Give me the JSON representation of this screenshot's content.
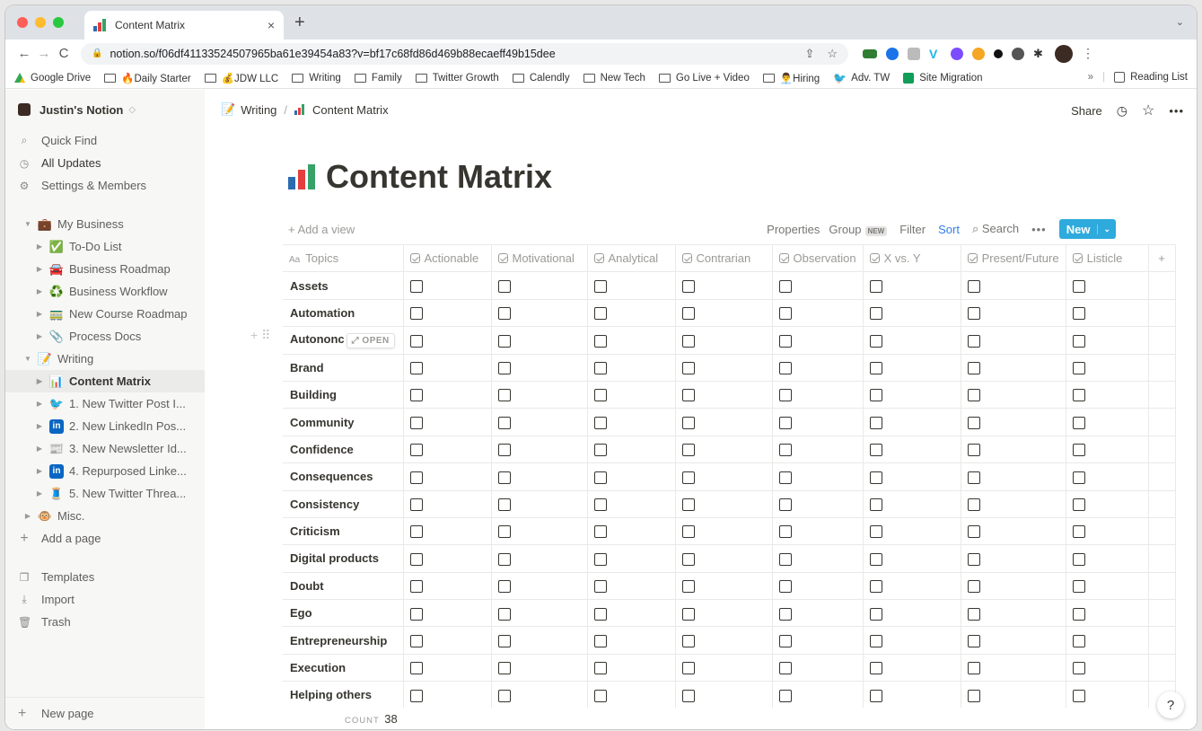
{
  "browser": {
    "tab_title": "Content Matrix",
    "tab_close": "×",
    "new_tab": "+",
    "tab_menu": "⌄",
    "url": "notion.so/f06df41133524507965ba61e39454a83?v=bf17c68fd86d469b88ecaeff49b15dee",
    "nav": {
      "back": "←",
      "forward": "→",
      "reload": "C"
    },
    "bookmarks": [
      {
        "label": "Google Drive",
        "icon": "google-drive-icon"
      },
      {
        "label": "🔥Daily Starter",
        "icon": "folder-icon"
      },
      {
        "label": "💰JDW LLC",
        "icon": "folder-icon"
      },
      {
        "label": "Writing",
        "icon": "folder-icon"
      },
      {
        "label": "Family",
        "icon": "folder-icon"
      },
      {
        "label": "Twitter Growth",
        "icon": "folder-icon"
      },
      {
        "label": "Calendly",
        "icon": "folder-icon"
      },
      {
        "label": "New Tech",
        "icon": "folder-icon"
      },
      {
        "label": "Go Live + Video",
        "icon": "folder-icon"
      },
      {
        "label": "👨‍💼Hiring",
        "icon": "folder-icon"
      },
      {
        "label": "Adv. TW",
        "icon": "twitter-icon"
      },
      {
        "label": "Site Migration",
        "icon": "google-sheets-icon"
      }
    ],
    "overflow": "»",
    "reading_list": "Reading List"
  },
  "sidebar": {
    "workspace": "Justin's Notion",
    "top_items": [
      {
        "label": "Quick Find",
        "icon": "⌕"
      },
      {
        "label": "All Updates",
        "icon": "◷"
      },
      {
        "label": "Settings & Members",
        "icon": "⚙"
      }
    ],
    "pages": [
      {
        "label": "My Business",
        "emoji": "💼",
        "level": 0,
        "open": true
      },
      {
        "label": "To-Do List",
        "emoji": "✅",
        "level": 1
      },
      {
        "label": "Business Roadmap",
        "emoji": "🚘",
        "level": 1
      },
      {
        "label": "Business Workflow",
        "emoji": "♻️",
        "level": 1
      },
      {
        "label": "New Course Roadmap",
        "emoji": "🚃",
        "level": 1
      },
      {
        "label": "Process Docs",
        "emoji": "📎",
        "level": 1
      },
      {
        "label": "Writing",
        "emoji": "📝",
        "level": 0,
        "open": true
      },
      {
        "label": "Content Matrix",
        "emoji": "📊",
        "level": 1,
        "active": true
      },
      {
        "label": "1. New Twitter Post I...",
        "emoji": "🐦",
        "level": 1
      },
      {
        "label": "2. New LinkedIn Pos...",
        "emoji": "in",
        "level": 1
      },
      {
        "label": "3. New Newsletter Id...",
        "emoji": "📰",
        "level": 1
      },
      {
        "label": "4. Repurposed Linke...",
        "emoji": "in",
        "level": 1
      },
      {
        "label": "5. New Twitter Threa...",
        "emoji": "🧵",
        "level": 1
      },
      {
        "label": "Misc.",
        "emoji": "🐵",
        "level": 0
      }
    ],
    "add_page": "Add a page",
    "bottom_items": [
      {
        "label": "Templates",
        "icon": "❐"
      },
      {
        "label": "Import",
        "icon": "⤓"
      },
      {
        "label": "Trash",
        "icon": "🗑"
      }
    ],
    "new_page": "New page"
  },
  "topbar": {
    "breadcrumb": [
      "Writing",
      "Content Matrix"
    ],
    "share": "Share",
    "more": "•••"
  },
  "page": {
    "title": "Content Matrix",
    "add_view": "+ Add a view",
    "view_controls": [
      "Properties",
      "Group",
      "Filter",
      "Sort",
      "Search"
    ],
    "group_badge": "NEW",
    "more": "•••",
    "new_button": "New",
    "new_chevron": "⌄"
  },
  "table": {
    "title_column": "Topics",
    "title_column_icon": "Aa",
    "columns": [
      "Actionable",
      "Motivational",
      "Analytical",
      "Contrarian",
      "Observation",
      "X vs. Y",
      "Present/Future",
      "Listicle"
    ],
    "add_column": "+",
    "rows": [
      "Assets",
      "Automation",
      "Autonomy",
      "Brand",
      "Building",
      "Community",
      "Confidence",
      "Consequences",
      "Consistency",
      "Criticism",
      "Digital products",
      "Doubt",
      "Ego",
      "Entrepreneurship",
      "Execution",
      "Helping others"
    ],
    "hover_row_label": "Autononc",
    "open_chip": "⤢ OPEN",
    "count_label": "COUNT",
    "count_value": "38"
  },
  "help": "?"
}
